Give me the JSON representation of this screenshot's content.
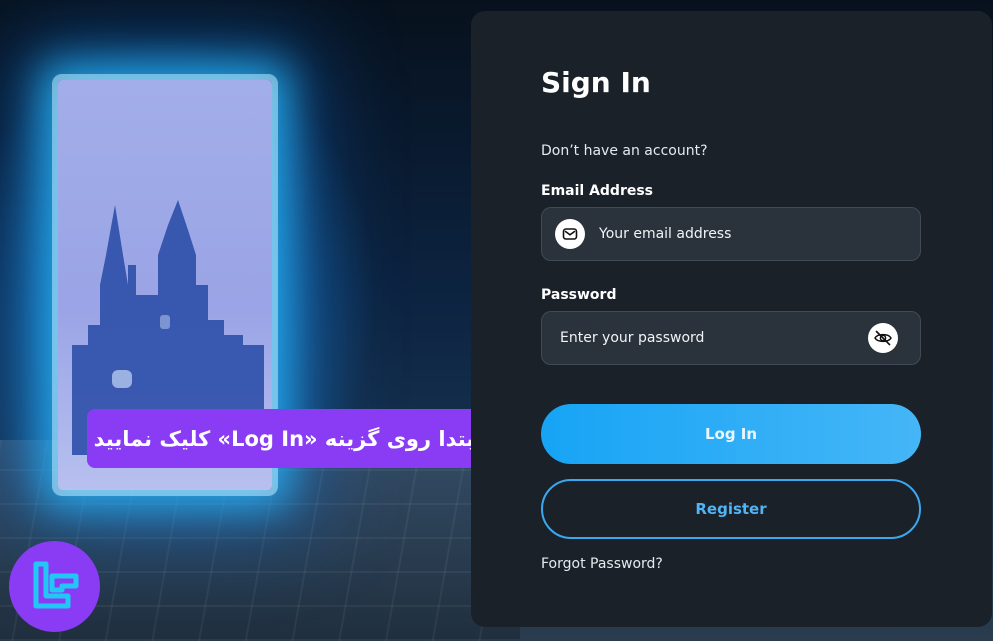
{
  "caption": {
    "text": "ابتدا روی گزینه «Log In» کلیک نمایید"
  },
  "signin": {
    "title": "Sign In",
    "no_account_text": "Don’t have an account?",
    "email": {
      "label": "Email Address",
      "placeholder": "Your email address",
      "icon": "mail-icon"
    },
    "password": {
      "label": "Password",
      "placeholder": "Enter your password",
      "icon": "eye-off-icon"
    },
    "login_button": "Log In",
    "register_button": "Register",
    "forgot_link": "Forgot Password?"
  },
  "colors": {
    "card_bg": "#1a2129",
    "accent_blue": "#27abf6",
    "caption_bg": "#8a3cf5",
    "brand_bg": "#8a3cf5"
  }
}
